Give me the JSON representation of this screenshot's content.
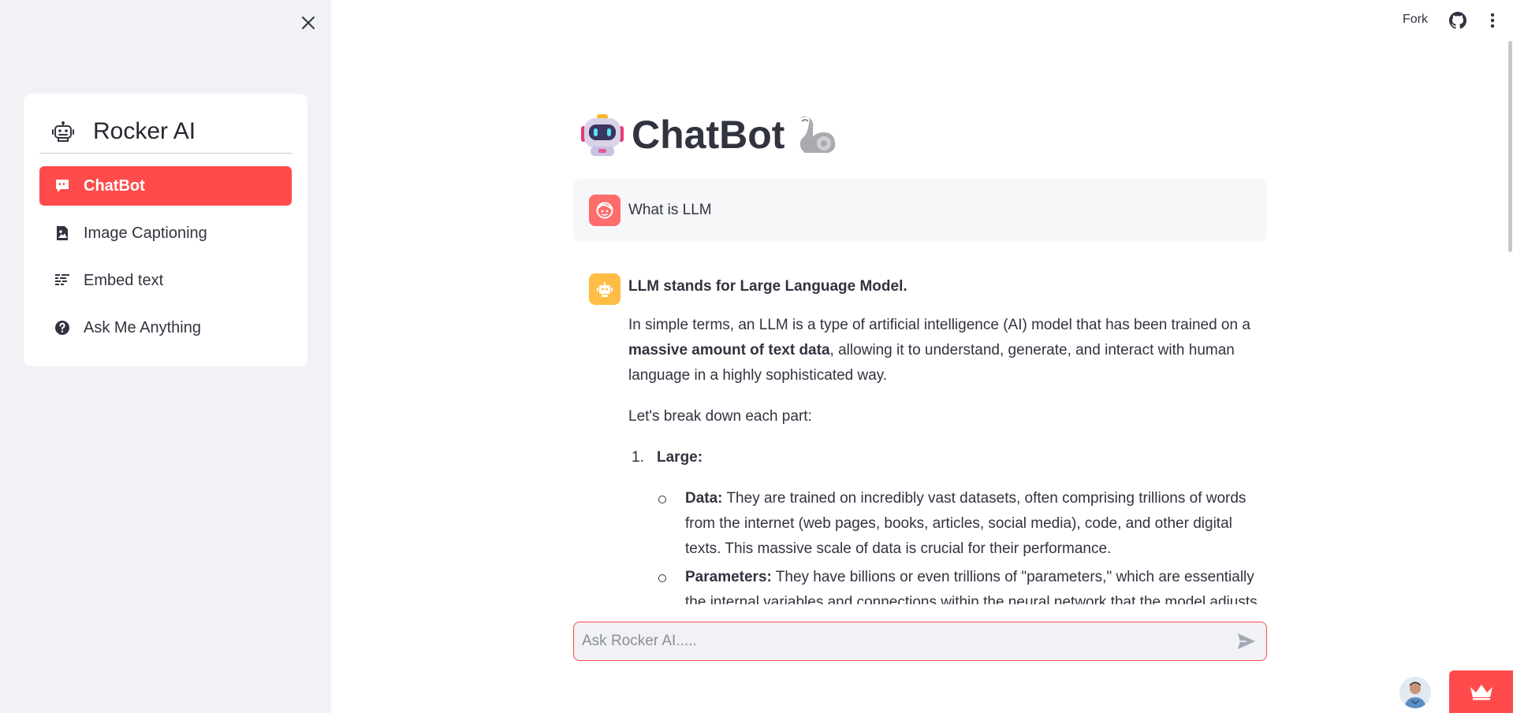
{
  "sidebar": {
    "brand": "Rocker AI",
    "close_icon": "close-icon",
    "items": [
      {
        "label": "ChatBot",
        "icon": "chat-bubble-icon",
        "active": true
      },
      {
        "label": "Image Captioning",
        "icon": "image-file-icon",
        "active": false
      },
      {
        "label": "Embed text",
        "icon": "text-lines-icon",
        "active": false
      },
      {
        "label": "Ask Me Anything",
        "icon": "question-circle-icon",
        "active": false
      }
    ]
  },
  "topbar": {
    "fork_label": "Fork",
    "github_icon": "github-icon",
    "menu_icon": "kebab-menu-icon"
  },
  "main": {
    "title": "ChatBot",
    "title_left_icon": "robot-emoji-icon",
    "title_right_icon": "flexed-bicep-emoji-icon",
    "user_message": {
      "text": "What is LLM",
      "avatar_icon": "user-face-icon"
    },
    "bot_message": {
      "avatar_icon": "robot-icon",
      "headline": "LLM stands for Large Language Model.",
      "intro_part1": "In simple terms, an LLM is a type of artificial intelligence (AI) model that has been trained on a ",
      "intro_bold": "massive amount of text data",
      "intro_part2": ", allowing it to understand, generate, and interact with human language in a highly sophisticated way.",
      "breakdown": "Let's break down each part:",
      "list": [
        {
          "number": "1.",
          "title": "Large:",
          "subitems": [
            {
              "bold": "Data:",
              "text": " They are trained on incredibly vast datasets, often comprising trillions of words from the internet (web pages, books, articles, social media), code, and other digital texts. This massive scale of data is crucial for their performance."
            },
            {
              "bold": "Parameters:",
              "text": " They have billions or even trillions of \"parameters,\" which are essentially the internal variables and connections within the neural network that the model adjusts"
            }
          ]
        }
      ]
    }
  },
  "chat_input": {
    "placeholder": "Ask Rocker AI.....",
    "value": "",
    "send_icon": "send-icon"
  },
  "footer": {
    "creator_avatar": "creator-avatar",
    "badge_icon": "crown-icon"
  },
  "colors": {
    "accent": "#ff4b4b",
    "sidebar_bg": "#f0f2f6",
    "user_avatar": "#ff6c6c",
    "bot_avatar": "#ffbd45",
    "text": "#31333f"
  }
}
